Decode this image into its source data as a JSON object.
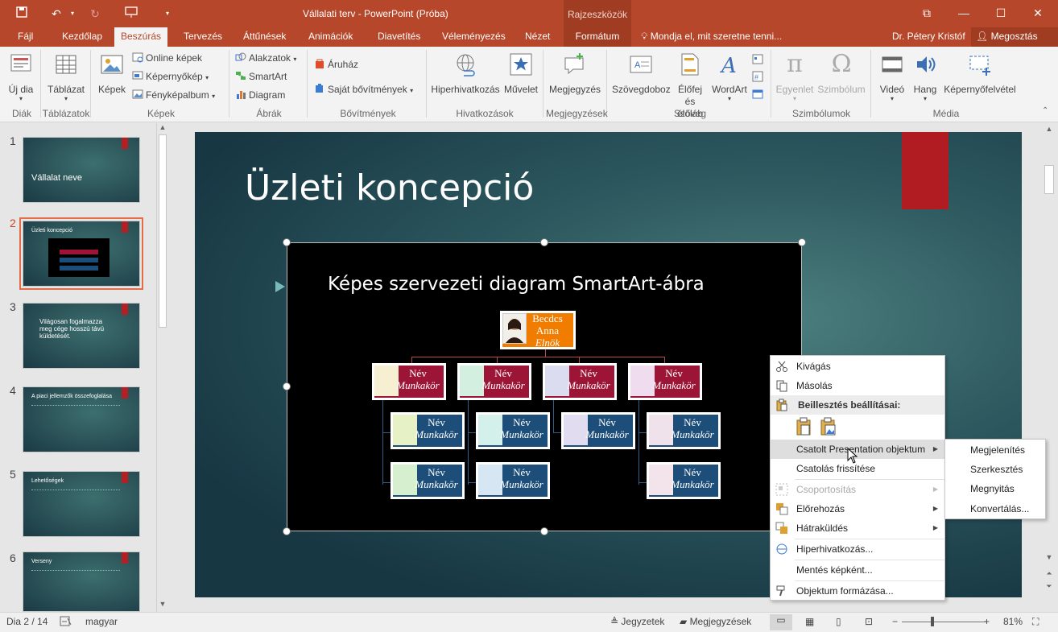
{
  "window": {
    "title": "Vállalati terv - PowerPoint (Próba)",
    "contextual_group": "Rajzeszközök"
  },
  "tabs": [
    {
      "label": "Fájl"
    },
    {
      "label": "Kezdőlap"
    },
    {
      "label": "Beszúrás",
      "active": true
    },
    {
      "label": "Tervezés"
    },
    {
      "label": "Áttűnések"
    },
    {
      "label": "Animációk"
    },
    {
      "label": "Diavetítés"
    },
    {
      "label": "Véleményezés"
    },
    {
      "label": "Nézet"
    },
    {
      "label": "Formátum"
    }
  ],
  "tell_me": "Mondja el, mit szeretne tenni...",
  "user": "Dr. Pétery Kristóf",
  "share": "Megosztás",
  "ribbon": {
    "new_slide": "Új dia",
    "table": "Táblázat",
    "pictures": "Képek",
    "online_pictures": "Online képek",
    "screenshot": "Képernyőkép",
    "photo_album": "Fényképalbum",
    "shapes": "Alakzatok",
    "smartart": "SmartArt",
    "chart": "Diagram",
    "store": "Áruház",
    "my_addins": "Saját bővítmények",
    "hyperlink": "Hiperhivatkozás",
    "action": "Művelet",
    "comment": "Megjegyzés",
    "textbox": "Szövegdoboz",
    "header_footer_1": "Élőfej és",
    "header_footer_2": "élőláb",
    "wordart": "WordArt",
    "equation": "Egyenlet",
    "symbol": "Szimbólum",
    "video": "Videó",
    "audio": "Hang",
    "screen_recording": "Képernyőfelvétel",
    "groups": {
      "slides": "Diák",
      "tables": "Táblázatok",
      "images": "Képek",
      "illustrations": "Ábrák",
      "addins": "Bővítmények",
      "links": "Hivatkozások",
      "comments": "Megjegyzések",
      "text": "Szöveg",
      "symbols": "Szimbólumok",
      "media": "Média"
    }
  },
  "thumbnails": [
    {
      "num": "1",
      "title": "Vállalat neve"
    },
    {
      "num": "2",
      "title": "Üzleti koncepció"
    },
    {
      "num": "3",
      "title": "Világosan fogalmazza meg cége hosszú távú küldetését."
    },
    {
      "num": "4",
      "title": "A piaci jellemzők összefoglalása"
    },
    {
      "num": "5",
      "title": "Lehetőségek"
    },
    {
      "num": "6",
      "title": "Verseny"
    }
  ],
  "slide": {
    "title": "Üzleti koncepció",
    "object_title": "Képes szervezeti diagram SmartArt-ábra",
    "top_node": {
      "line1": "Becdcs",
      "line2": "Anna",
      "line3": "Elnök"
    },
    "node_name": "Név",
    "node_role": "Munkakör"
  },
  "context_menu": {
    "cut": "Kivágás",
    "copy": "Másolás",
    "paste_options": "Beillesztés beállításai:",
    "linked_object": "Csatolt Presentation objektum",
    "update_link": "Csatolás frissítése",
    "group": "Csoportosítás",
    "bring_forward": "Előrehozás",
    "send_backward": "Hátraküldés",
    "hyperlink": "Hiperhivatkozás...",
    "save_as_picture": "Mentés képként...",
    "format_object": "Objektum formázása..."
  },
  "submenu": {
    "show": "Megjelenítés",
    "edit": "Szerkesztés",
    "open": "Megnyitás",
    "convert": "Konvertálás..."
  },
  "status": {
    "slide_counter": "Dia 2 / 14",
    "language": "magyar",
    "notes": "Jegyzetek",
    "comments": "Megjegyzések",
    "zoom": "81%"
  }
}
